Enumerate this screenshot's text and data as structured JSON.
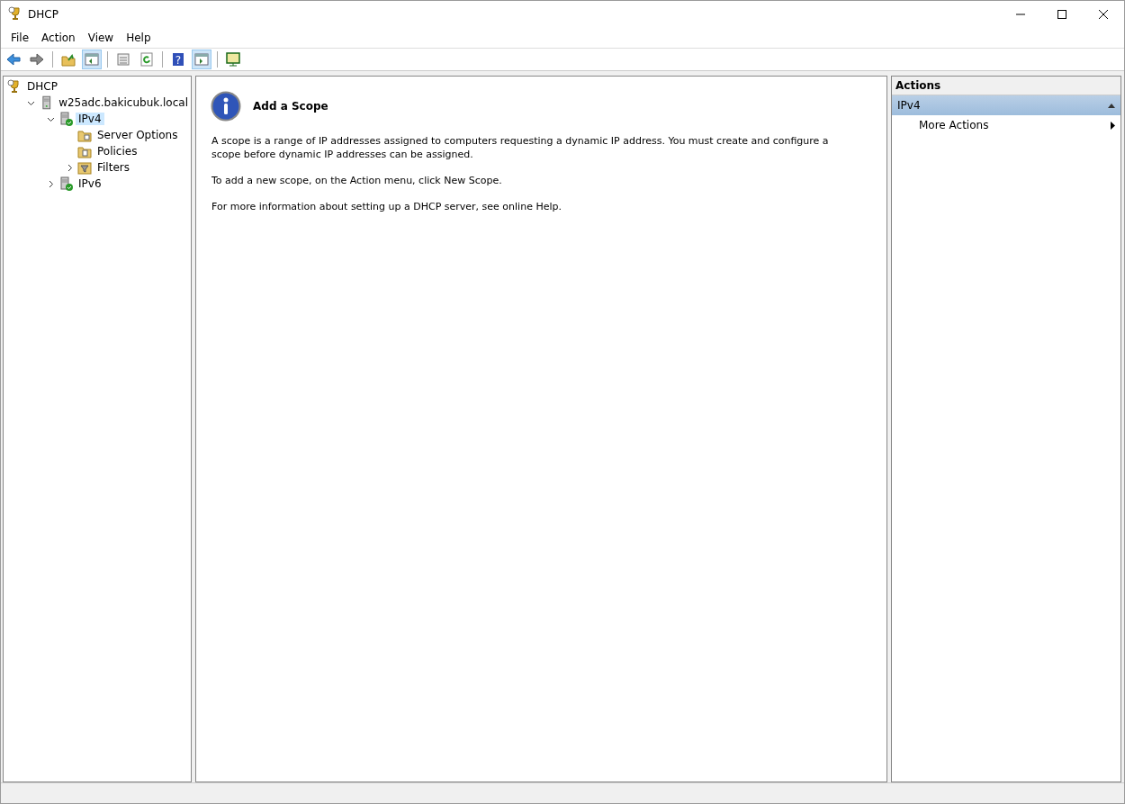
{
  "window": {
    "title": "DHCP"
  },
  "menu": [
    "File",
    "Action",
    "View",
    "Help"
  ],
  "toolbar": [
    {
      "kind": "back",
      "on": false
    },
    {
      "kind": "forward",
      "on": false
    },
    {
      "kind": "sep"
    },
    {
      "kind": "up",
      "on": false
    },
    {
      "kind": "tree",
      "on": true
    },
    {
      "kind": "sep"
    },
    {
      "kind": "export",
      "on": false
    },
    {
      "kind": "refresh",
      "on": false
    },
    {
      "kind": "sep"
    },
    {
      "kind": "help",
      "on": false,
      "glyph": "?"
    },
    {
      "kind": "pane",
      "on": true
    },
    {
      "kind": "sep"
    },
    {
      "kind": "monitor",
      "on": false
    }
  ],
  "tree": [
    {
      "label": "DHCP",
      "kind": "dhcp",
      "selected": false,
      "children": [
        {
          "label": "w25adc.bakicubuk.local",
          "kind": "server",
          "selected": false,
          "expanded": true,
          "children": [
            {
              "label": "IPv4",
              "kind": "ip",
              "selected": true,
              "expanded": true,
              "children": [
                {
                  "label": "Server Options",
                  "kind": "options",
                  "selected": false
                },
                {
                  "label": "Policies",
                  "kind": "policies",
                  "selected": false
                },
                {
                  "label": "Filters",
                  "kind": "filters",
                  "selected": false,
                  "expanded": false
                }
              ]
            },
            {
              "label": "IPv6",
              "kind": "ip",
              "selected": false,
              "expanded": false
            }
          ]
        }
      ]
    }
  ],
  "content": {
    "heading": "Add a Scope",
    "paragraphs": [
      "A scope is a range of IP addresses assigned to computers requesting a dynamic IP address. You must create and configure a scope before dynamic IP addresses can be assigned.",
      "To add a new scope, on the Action menu, click New Scope.",
      "For more information about setting up a DHCP server, see online Help."
    ]
  },
  "actions": {
    "title": "Actions",
    "section": "IPv4",
    "items": [
      "More Actions"
    ]
  }
}
